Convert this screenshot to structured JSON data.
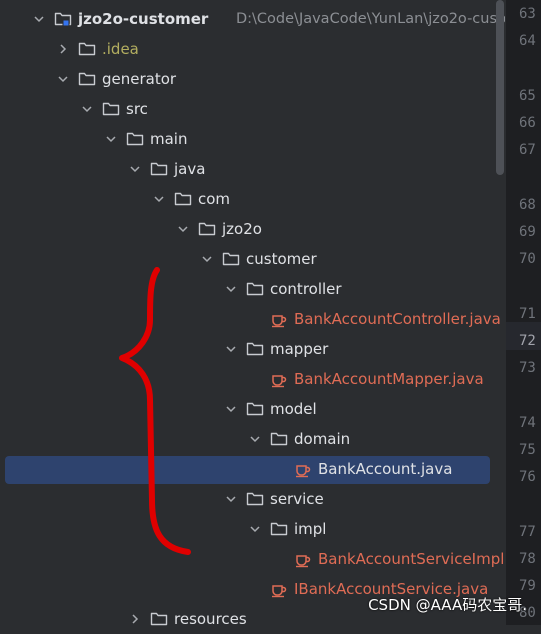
{
  "tree": {
    "root": {
      "name": "jzo2o-customer",
      "path": "D:\\Code\\JavaCode\\YunLan\\jzo2o-custo"
    },
    "nodes": [
      {
        "label": "jzo2o-customer",
        "kind": "module",
        "depth": 0,
        "expanded": true
      },
      {
        "label": ".idea",
        "kind": "folder",
        "depth": 1,
        "expanded": false
      },
      {
        "label": "generator",
        "kind": "folder",
        "depth": 1,
        "expanded": true
      },
      {
        "label": "src",
        "kind": "folder",
        "depth": 2,
        "expanded": true
      },
      {
        "label": "main",
        "kind": "folder",
        "depth": 3,
        "expanded": true
      },
      {
        "label": "java",
        "kind": "folder",
        "depth": 4,
        "expanded": true
      },
      {
        "label": "com",
        "kind": "folder",
        "depth": 5,
        "expanded": true
      },
      {
        "label": "jzo2o",
        "kind": "folder",
        "depth": 6,
        "expanded": true
      },
      {
        "label": "customer",
        "kind": "folder",
        "depth": 7,
        "expanded": true
      },
      {
        "label": "controller",
        "kind": "folder",
        "depth": 8,
        "expanded": true
      },
      {
        "label": "BankAccountController.java",
        "kind": "java",
        "depth": 9
      },
      {
        "label": "mapper",
        "kind": "folder",
        "depth": 8,
        "expanded": true
      },
      {
        "label": "BankAccountMapper.java",
        "kind": "java",
        "depth": 9
      },
      {
        "label": "model",
        "kind": "folder",
        "depth": 8,
        "expanded": true
      },
      {
        "label": "domain",
        "kind": "folder",
        "depth": 9,
        "expanded": true
      },
      {
        "label": "BankAccount.java",
        "kind": "java",
        "depth": 10,
        "selected": true
      },
      {
        "label": "service",
        "kind": "folder",
        "depth": 8,
        "expanded": true
      },
      {
        "label": "impl",
        "kind": "folder",
        "depth": 9,
        "expanded": true
      },
      {
        "label": "BankAccountServiceImpl.java",
        "kind": "java",
        "depth": 10
      },
      {
        "label": "IBankAccountService.java",
        "kind": "java",
        "depth": 9
      },
      {
        "label": "resources",
        "kind": "folder",
        "depth": 4,
        "expanded": false
      }
    ]
  },
  "gutter": {
    "line_numbers": [
      {
        "n": "63"
      },
      {
        "n": "64"
      },
      {
        "n": "65"
      },
      {
        "n": "66"
      },
      {
        "n": "67"
      },
      {
        "n": "68"
      },
      {
        "n": "69"
      },
      {
        "n": "70"
      },
      {
        "n": "71"
      },
      {
        "n": "72",
        "current": true
      },
      {
        "n": "73"
      },
      {
        "n": "74"
      },
      {
        "n": "75"
      },
      {
        "n": "76"
      },
      {
        "n": "77"
      },
      {
        "n": "78"
      },
      {
        "n": "79"
      },
      {
        "n": "80"
      }
    ]
  },
  "watermark": "CSDN @AAA码农宝哥.",
  "colors": {
    "background": "#2b2d30",
    "selection": "#2e436e",
    "java_file": "#e06c55",
    "idea_folder": "#b3ae60",
    "annotation_brace": "#e00000"
  }
}
